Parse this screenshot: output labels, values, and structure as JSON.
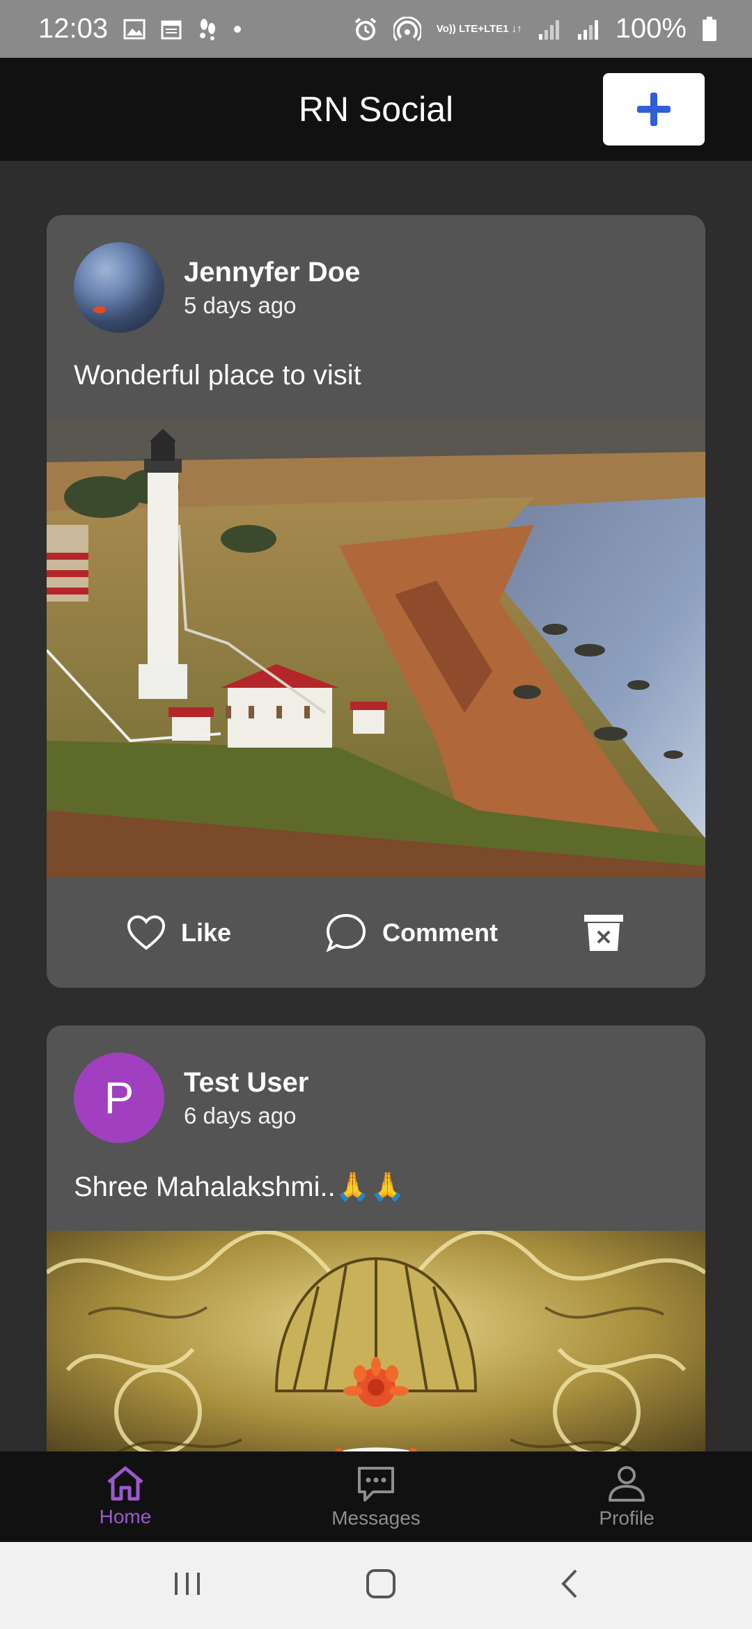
{
  "status_bar": {
    "time": "12:03",
    "network_top": "Vo)) LTE+",
    "network_bottom": "LTE1 ↓↑",
    "battery": "100%"
  },
  "app_bar": {
    "title": "RN Social",
    "add_icon": "plus-icon",
    "accent": "#2f5fd6"
  },
  "posts": [
    {
      "user_name": "Jennyfer Doe",
      "time": "5 days ago",
      "text": "Wonderful place to visit",
      "image": "lighthouse-coast-photo",
      "actions": {
        "like": "Like",
        "comment": "Comment"
      }
    },
    {
      "user_name": "Test User",
      "avatar_letter": "P",
      "avatar_color": "#a040c0",
      "time": "6 days ago",
      "text": "Shree Mahalakshmi..🙏🙏",
      "image": "ornate-golden-shrine-photo"
    }
  ],
  "bottom_nav": {
    "items": [
      {
        "label": "Home",
        "icon": "home-icon",
        "active": true
      },
      {
        "label": "Messages",
        "icon": "chat-bubble-icon",
        "active": false
      },
      {
        "label": "Profile",
        "icon": "person-icon",
        "active": false
      }
    ],
    "active_color": "#9b59d0"
  }
}
